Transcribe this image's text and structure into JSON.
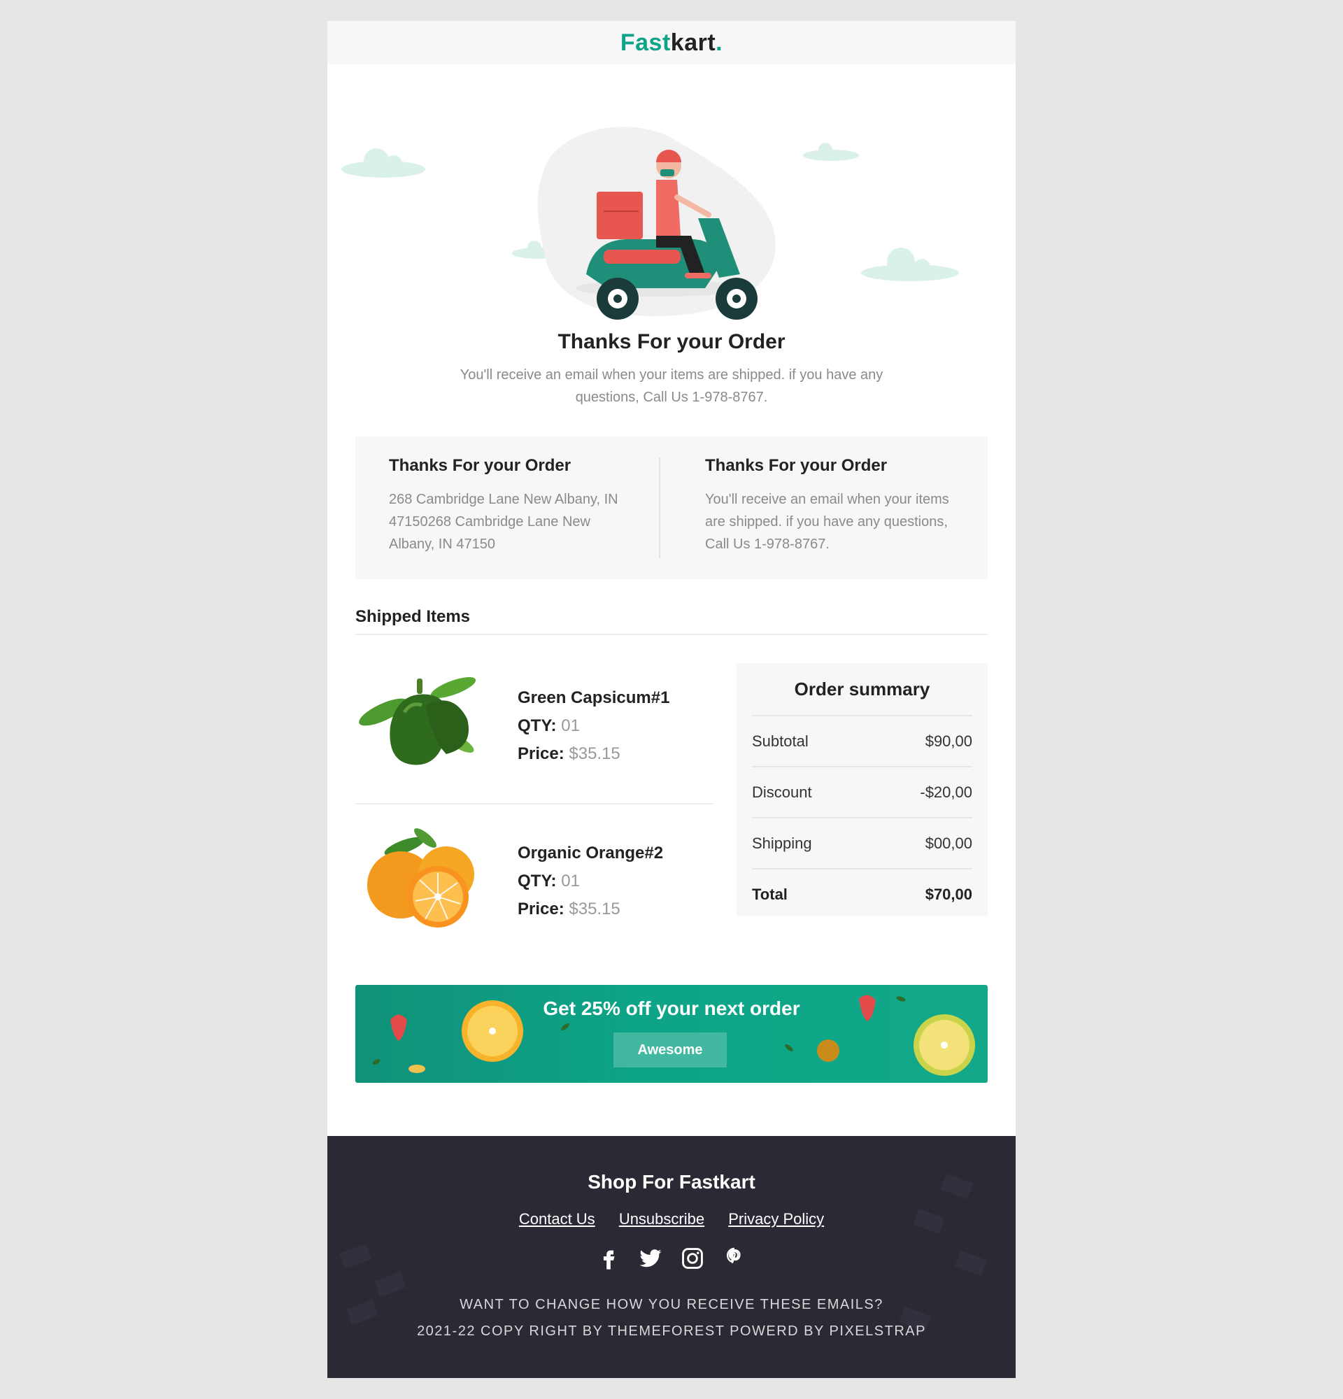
{
  "brand": {
    "logo_part1": "Fast",
    "logo_part2": "kart",
    "logo_dot": ".",
    "accent": "#0da487",
    "dark": "#2a2a35"
  },
  "hero": {
    "illustration": "delivery-scooter-illustration",
    "title": "Thanks For your Order",
    "message": "You'll receive an email when your items are shipped. if you have any questions, Call Us 1-978-8767."
  },
  "info": {
    "left": {
      "title": "Thanks For your Order",
      "text": "268 Cambridge Lane New Albany, IN 47150268 Cambridge Lane New Albany, IN 47150"
    },
    "right": {
      "title": "Thanks For your Order",
      "text": "You'll receive an email when your items are shipped. if you have any questions, Call Us 1-978-8767."
    }
  },
  "shipped": {
    "title": "Shipped Items",
    "items": [
      {
        "name": "Green Capsicum#1",
        "qty_label": "QTY:",
        "qty": "01",
        "price_label": "Price:",
        "price": "$35.15",
        "image": "green-capsicum"
      },
      {
        "name": "Organic Orange#2",
        "qty_label": "QTY:",
        "qty": "01",
        "price_label": "Price:",
        "price": "$35.15",
        "image": "organic-orange"
      }
    ]
  },
  "summary": {
    "title": "Order summary",
    "rows": [
      {
        "label": "Subtotal",
        "value": "$90,00"
      },
      {
        "label": "Discount",
        "value": "-$20,00"
      },
      {
        "label": "Shipping",
        "value": "$00,00"
      },
      {
        "label": "Total",
        "value": "$70,00"
      }
    ]
  },
  "promo": {
    "title": "Get 25% off your next order",
    "button": "Awesome"
  },
  "footer": {
    "title": "Shop For Fastkart",
    "links": [
      "Contact Us",
      "Unsubscribe",
      "Privacy Policy"
    ],
    "social": [
      "facebook-icon",
      "twitter-icon",
      "instagram-icon",
      "pinterest-icon"
    ],
    "note1": "WANT TO CHANGE HOW YOU RECEIVE THESE EMAILS?",
    "note2": "2021-22 COPY RIGHT BY THEMEFOREST POWERD BY PIXELSTRAP"
  }
}
